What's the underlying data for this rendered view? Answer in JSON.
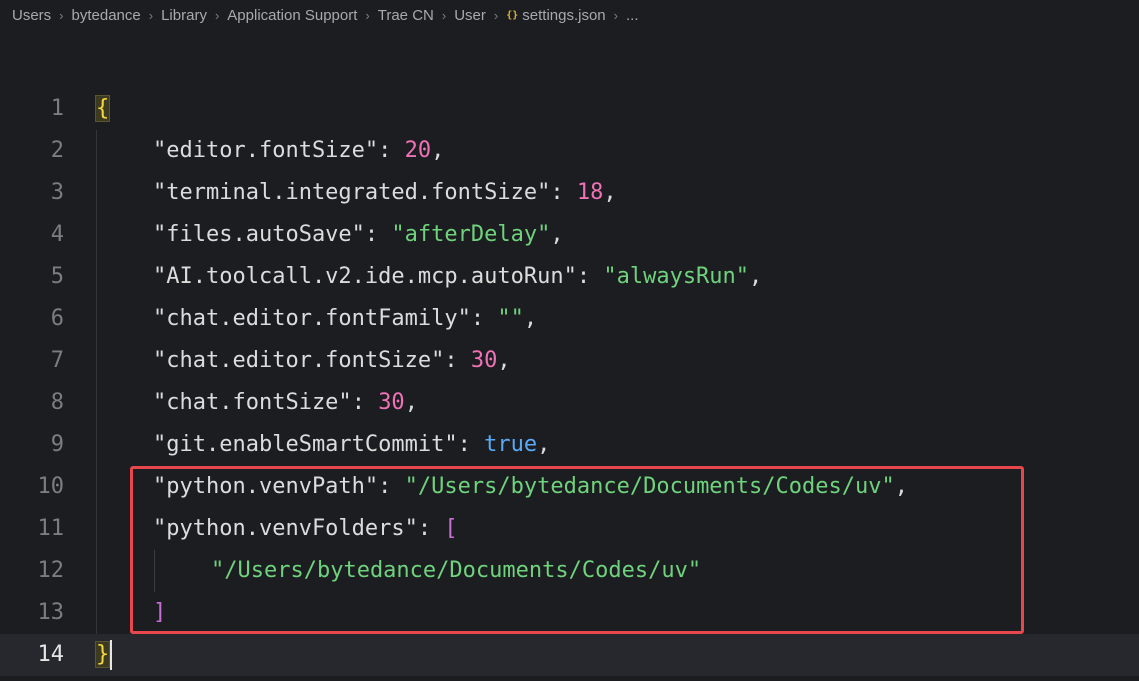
{
  "breadcrumb": {
    "items": [
      "Users",
      "bytedance",
      "Library",
      "Application Support",
      "Trae CN",
      "User",
      "settings.json",
      "..."
    ],
    "file_icon": "{}"
  },
  "lines": [
    {
      "n": "1",
      "open": "{"
    },
    {
      "n": "2",
      "key": "\"editor.fontSize\"",
      "colon": ": ",
      "value": "20",
      "comma": ","
    },
    {
      "n": "3",
      "key": "\"terminal.integrated.fontSize\"",
      "colon": ": ",
      "value": "18",
      "comma": ","
    },
    {
      "n": "4",
      "key": "\"files.autoSave\"",
      "colon": ": ",
      "value": "\"afterDelay\"",
      "comma": ","
    },
    {
      "n": "5",
      "key": "\"AI.toolcall.v2.ide.mcp.autoRun\"",
      "colon": ": ",
      "value": "\"alwaysRun\"",
      "comma": ","
    },
    {
      "n": "6",
      "key": "\"chat.editor.fontFamily\"",
      "colon": ": ",
      "value": "\"\"",
      "comma": ","
    },
    {
      "n": "7",
      "key": "\"chat.editor.fontSize\"",
      "colon": ": ",
      "value": "30",
      "comma": ","
    },
    {
      "n": "8",
      "key": "\"chat.fontSize\"",
      "colon": ": ",
      "value": "30",
      "comma": ","
    },
    {
      "n": "9",
      "key": "\"git.enableSmartCommit\"",
      "colon": ": ",
      "value": "true",
      "comma": ","
    },
    {
      "n": "10",
      "key": "\"python.venvPath\"",
      "colon": ": ",
      "value": "\"/Users/bytedance/Documents/Codes/uv\"",
      "comma": ","
    },
    {
      "n": "11",
      "key": "\"python.venvFolders\"",
      "colon": ": ",
      "value": "["
    },
    {
      "n": "12",
      "value": "\"/Users/bytedance/Documents/Codes/uv\""
    },
    {
      "n": "13",
      "value": "]"
    },
    {
      "n": "14",
      "close": "}"
    }
  ],
  "colors": {
    "highlight_box": "#e8474e",
    "string": "#6fd27c",
    "number": "#f072b6",
    "boolean": "#5aa9f5"
  }
}
